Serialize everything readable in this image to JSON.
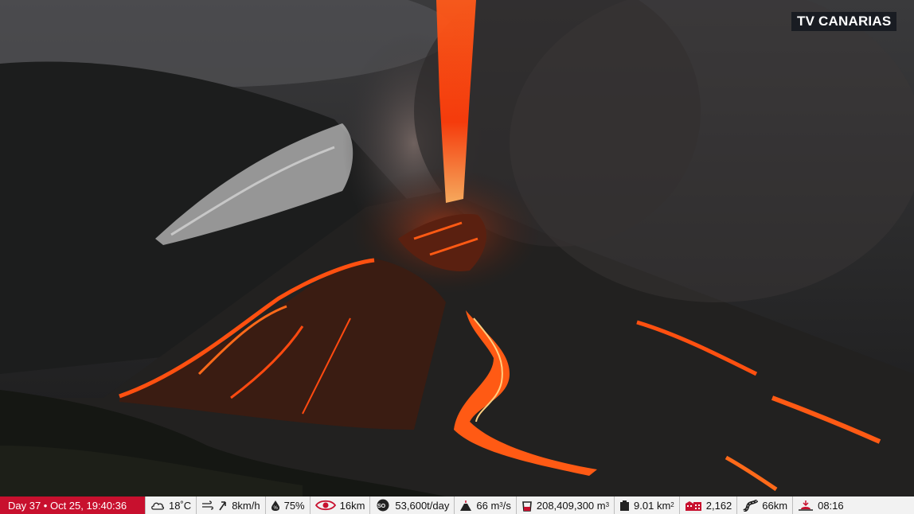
{
  "broadcaster": "TV CANARIAS",
  "status_bar": {
    "datetime": "Day 37 • Oct 25, 19:40:36",
    "temperature": "18˚C",
    "wind": "8km/h",
    "humidity": "75%",
    "visibility": "16km",
    "so2": "53,600t/day",
    "lava_flow_value": "66 m",
    "lava_flow_exp": "3",
    "lava_flow_unit": "/s",
    "volume_value": "208,409,300 m",
    "volume_exp": "3",
    "area_value": "9.01 km",
    "area_exp": "2",
    "buildings": "2,162",
    "road": "66km",
    "sunset": "08:16"
  },
  "icons": [
    "cloud-icon",
    "wind-icon",
    "arrow-direction-icon",
    "humidity-icon",
    "eye-icon",
    "so2-icon",
    "volcano-flow-icon",
    "bucket-icon",
    "area-icon",
    "building-icon",
    "road-icon",
    "sun-horizon-icon"
  ],
  "colors": {
    "date_bg": "#c8102e",
    "bar_bg": "#f2f2f2",
    "logo_bg": "#14181e",
    "lava": "#ff4a10"
  }
}
